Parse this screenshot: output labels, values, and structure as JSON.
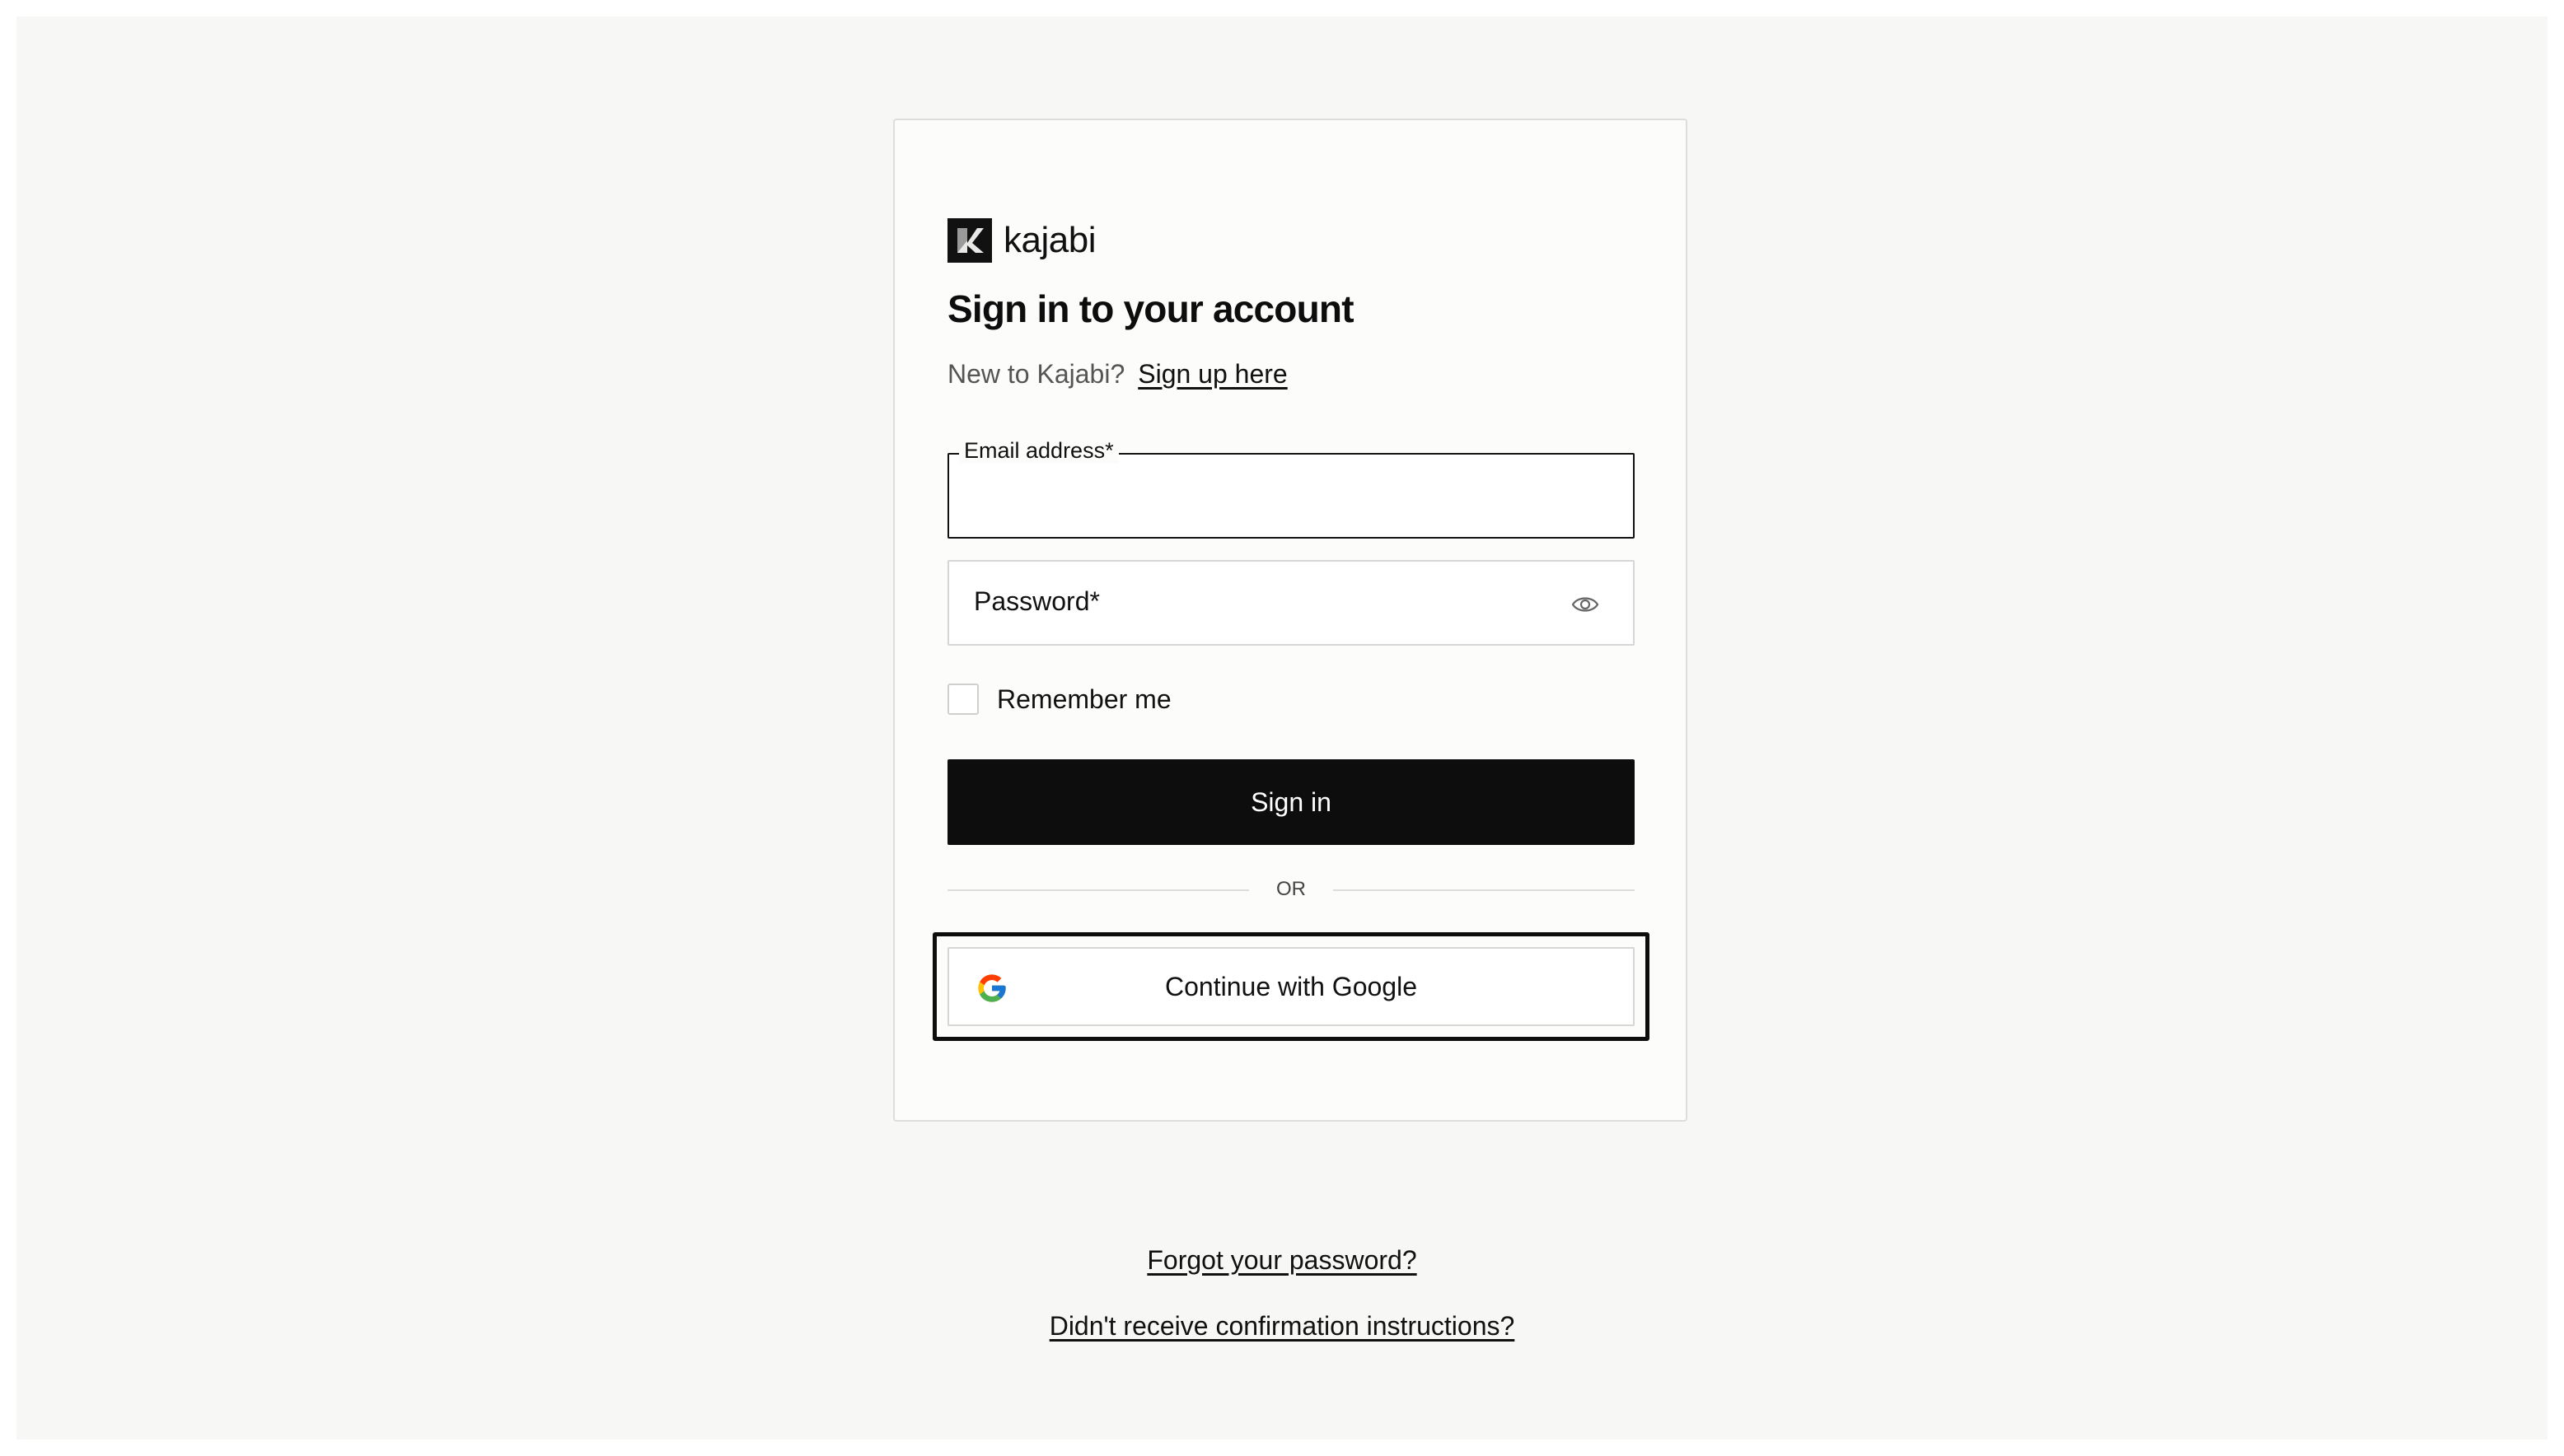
{
  "brand": {
    "name": "kajabi",
    "logo_icon": "kajabi-k-logo"
  },
  "header": {
    "title": "Sign in to your account"
  },
  "signup": {
    "prompt": "New to Kajabi?",
    "link_label": "Sign up here"
  },
  "form": {
    "email": {
      "label": "Email address*",
      "value": ""
    },
    "password": {
      "label": "Password*",
      "value": "",
      "toggle_icon": "eye-icon"
    },
    "remember": {
      "label": "Remember me",
      "checked": false
    },
    "submit_label": "Sign in",
    "divider_text": "OR",
    "google_label": "Continue with Google"
  },
  "footer": {
    "forgot_password": "Forgot your password?",
    "confirmation": "Didn't receive confirmation instructions?"
  },
  "colors": {
    "primary": "#0d0d0d",
    "background": "#f7f7f5",
    "card": "#fcfcfb",
    "border": "#d6d6d4"
  }
}
